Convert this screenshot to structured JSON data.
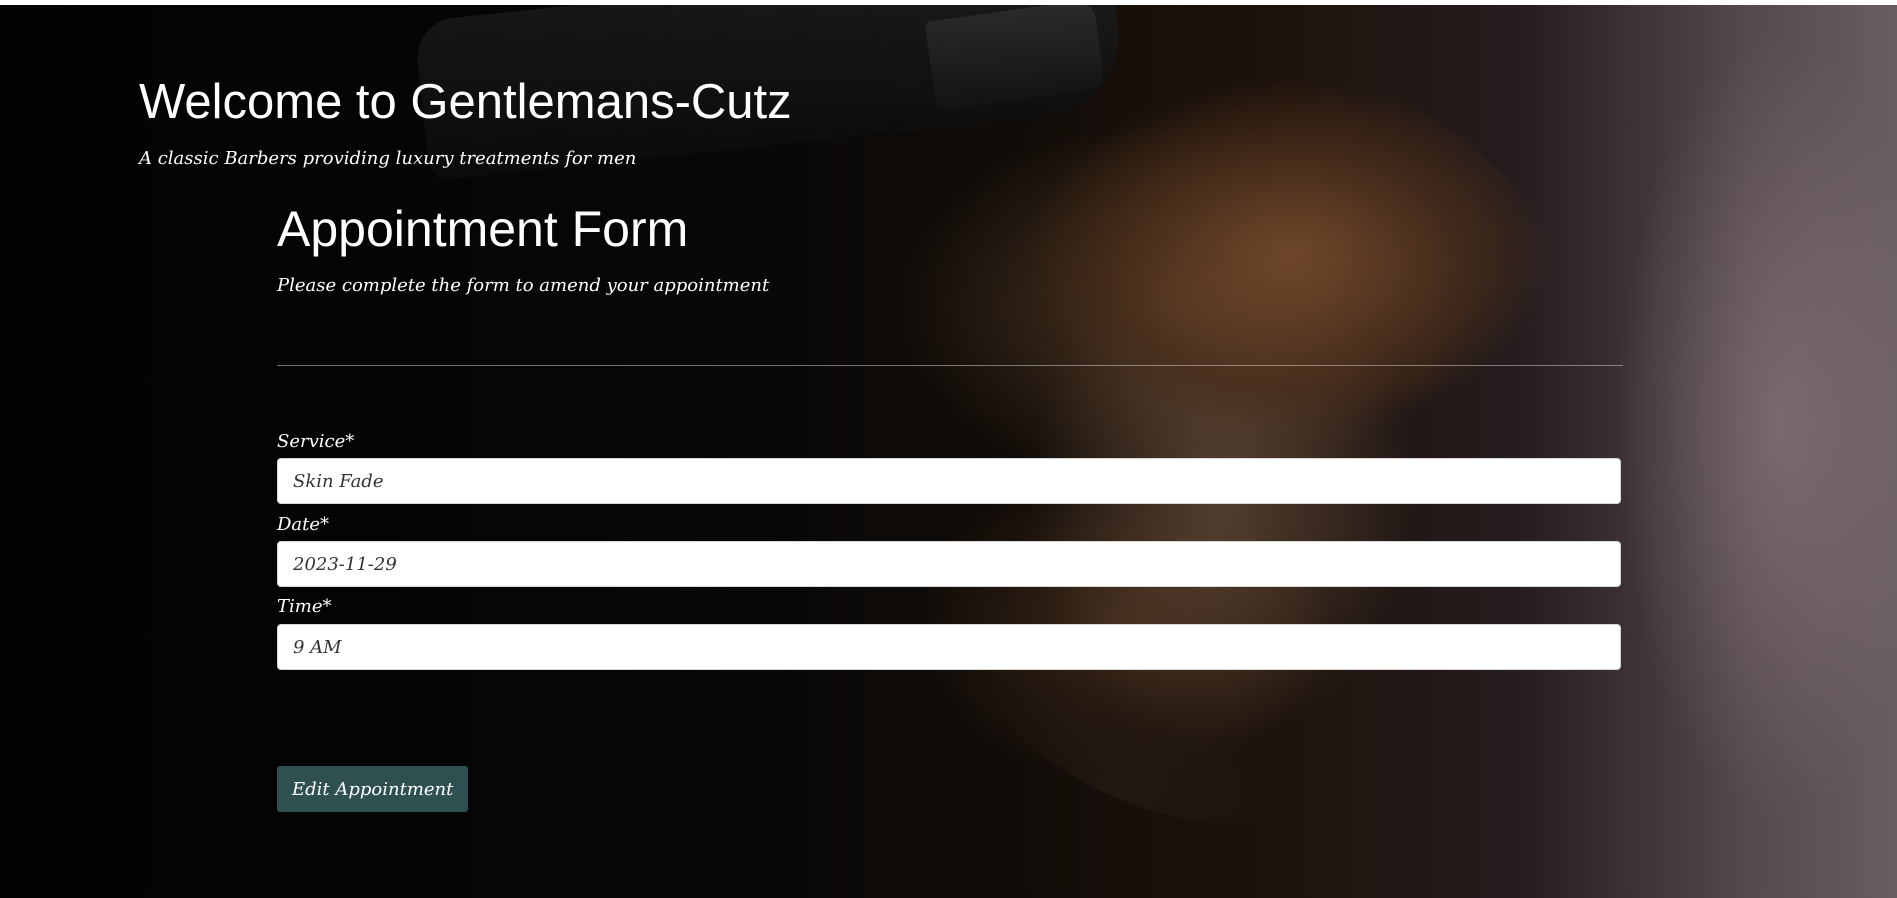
{
  "header": {
    "title": "Welcome to Gentlemans-Cutz",
    "tagline": "A classic Barbers providing luxury treatments for men"
  },
  "form": {
    "title": "Appointment Form",
    "subtitle": "Please complete the form to amend your appointment",
    "fields": {
      "service": {
        "label": "Service*",
        "value": "Skin Fade"
      },
      "date": {
        "label": "Date*",
        "value": "2023-11-29"
      },
      "time": {
        "label": "Time*",
        "value": "9 AM"
      }
    },
    "submit_label": "Edit Appointment"
  },
  "colors": {
    "button_bg": "#2f5051",
    "text": "#ffffff",
    "input_bg": "#ffffff"
  }
}
